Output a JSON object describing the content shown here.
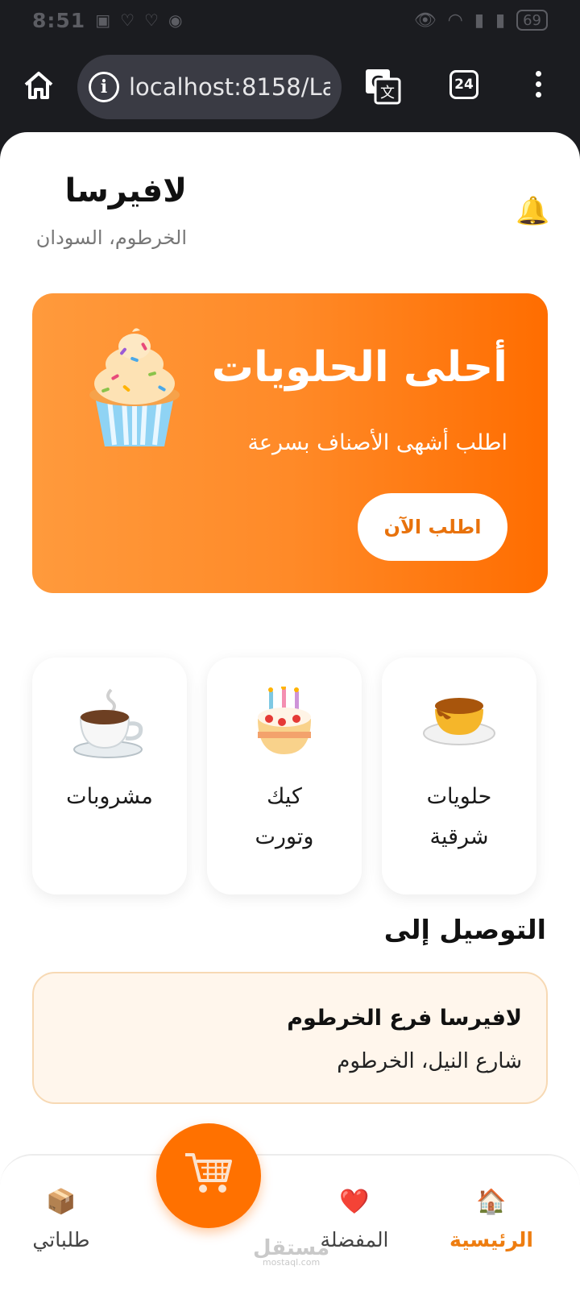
{
  "statusbar": {
    "time": "8:51",
    "battery": "69"
  },
  "browser": {
    "url": "localhost:8158/La",
    "tab_count": "24"
  },
  "header": {
    "brand": "لافيرسا",
    "location": "الخرطوم، السودان"
  },
  "hero": {
    "title": "أحلى الحلويات",
    "subtitle": "اطلب أشهى الأصناف بسرعة",
    "button_label": "اطلب الآن"
  },
  "categories": [
    {
      "label": "حلويات شرقية",
      "icon": "flan-icon"
    },
    {
      "label": "كيك وتورت",
      "icon": "cake-icon"
    },
    {
      "label": "مشروبات",
      "icon": "coffee-icon"
    }
  ],
  "delivery": {
    "title": "التوصيل إلى",
    "branch_name": "لافيرسا فرع الخرطوم",
    "address": "شارع النيل، الخرطوم"
  },
  "nav": {
    "home_label": "الرئيسية",
    "favorites_label": "المفضلة",
    "orders_label": "طلباتي"
  },
  "watermark": {
    "main": "مستقل",
    "sub": "mostaql.com"
  },
  "colors": {
    "accent": "#ff7100",
    "accent_text": "#ee7d10",
    "hero_start": "#ff9a3c",
    "hero_end": "#ff6d00",
    "delivery_bg": "#fff6ec"
  }
}
